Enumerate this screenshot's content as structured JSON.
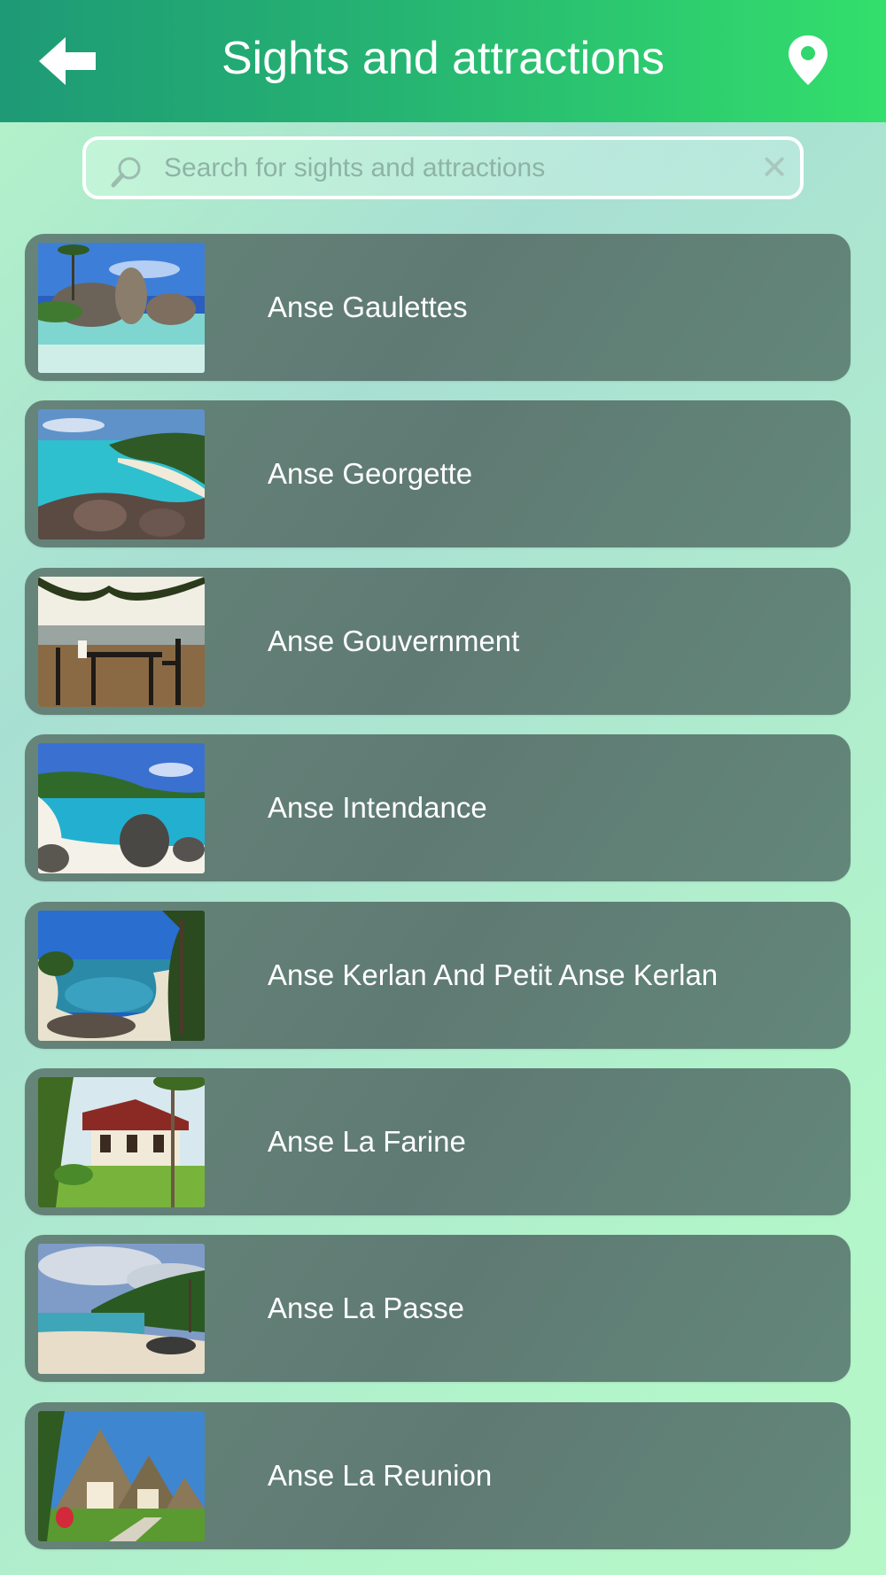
{
  "header": {
    "title": "Sights and attractions",
    "back_icon": "arrow-left-icon",
    "location_icon": "map-pin-icon"
  },
  "search": {
    "value": "",
    "placeholder": "Search for sights and attractions",
    "search_icon": "magnifier-icon",
    "clear_icon": "close-icon",
    "clear_glyph": "✕"
  },
  "attractions": [
    {
      "label": "Anse Gaulettes",
      "thumb": "beach-granite-rocks-photo"
    },
    {
      "label": "Anse Georgette",
      "thumb": "turquoise-bay-photo"
    },
    {
      "label": "Anse Gouvernment",
      "thumb": "beach-dining-table-photo"
    },
    {
      "label": "Anse Intendance",
      "thumb": "white-sand-boulders-photo"
    },
    {
      "label": "Anse Kerlan And Petit Anse Kerlan",
      "thumb": "palm-lagoon-photo"
    },
    {
      "label": "Anse La Farine",
      "thumb": "bungalow-garden-photo"
    },
    {
      "label": "Anse La Passe",
      "thumb": "cloudy-beach-photo"
    },
    {
      "label": "Anse La Reunion",
      "thumb": "thatched-huts-photo"
    }
  ],
  "colors": {
    "header_start": "#1e9a76",
    "header_end": "#33df6c",
    "card": "#5f7a73",
    "background": "#b4f5c8"
  }
}
